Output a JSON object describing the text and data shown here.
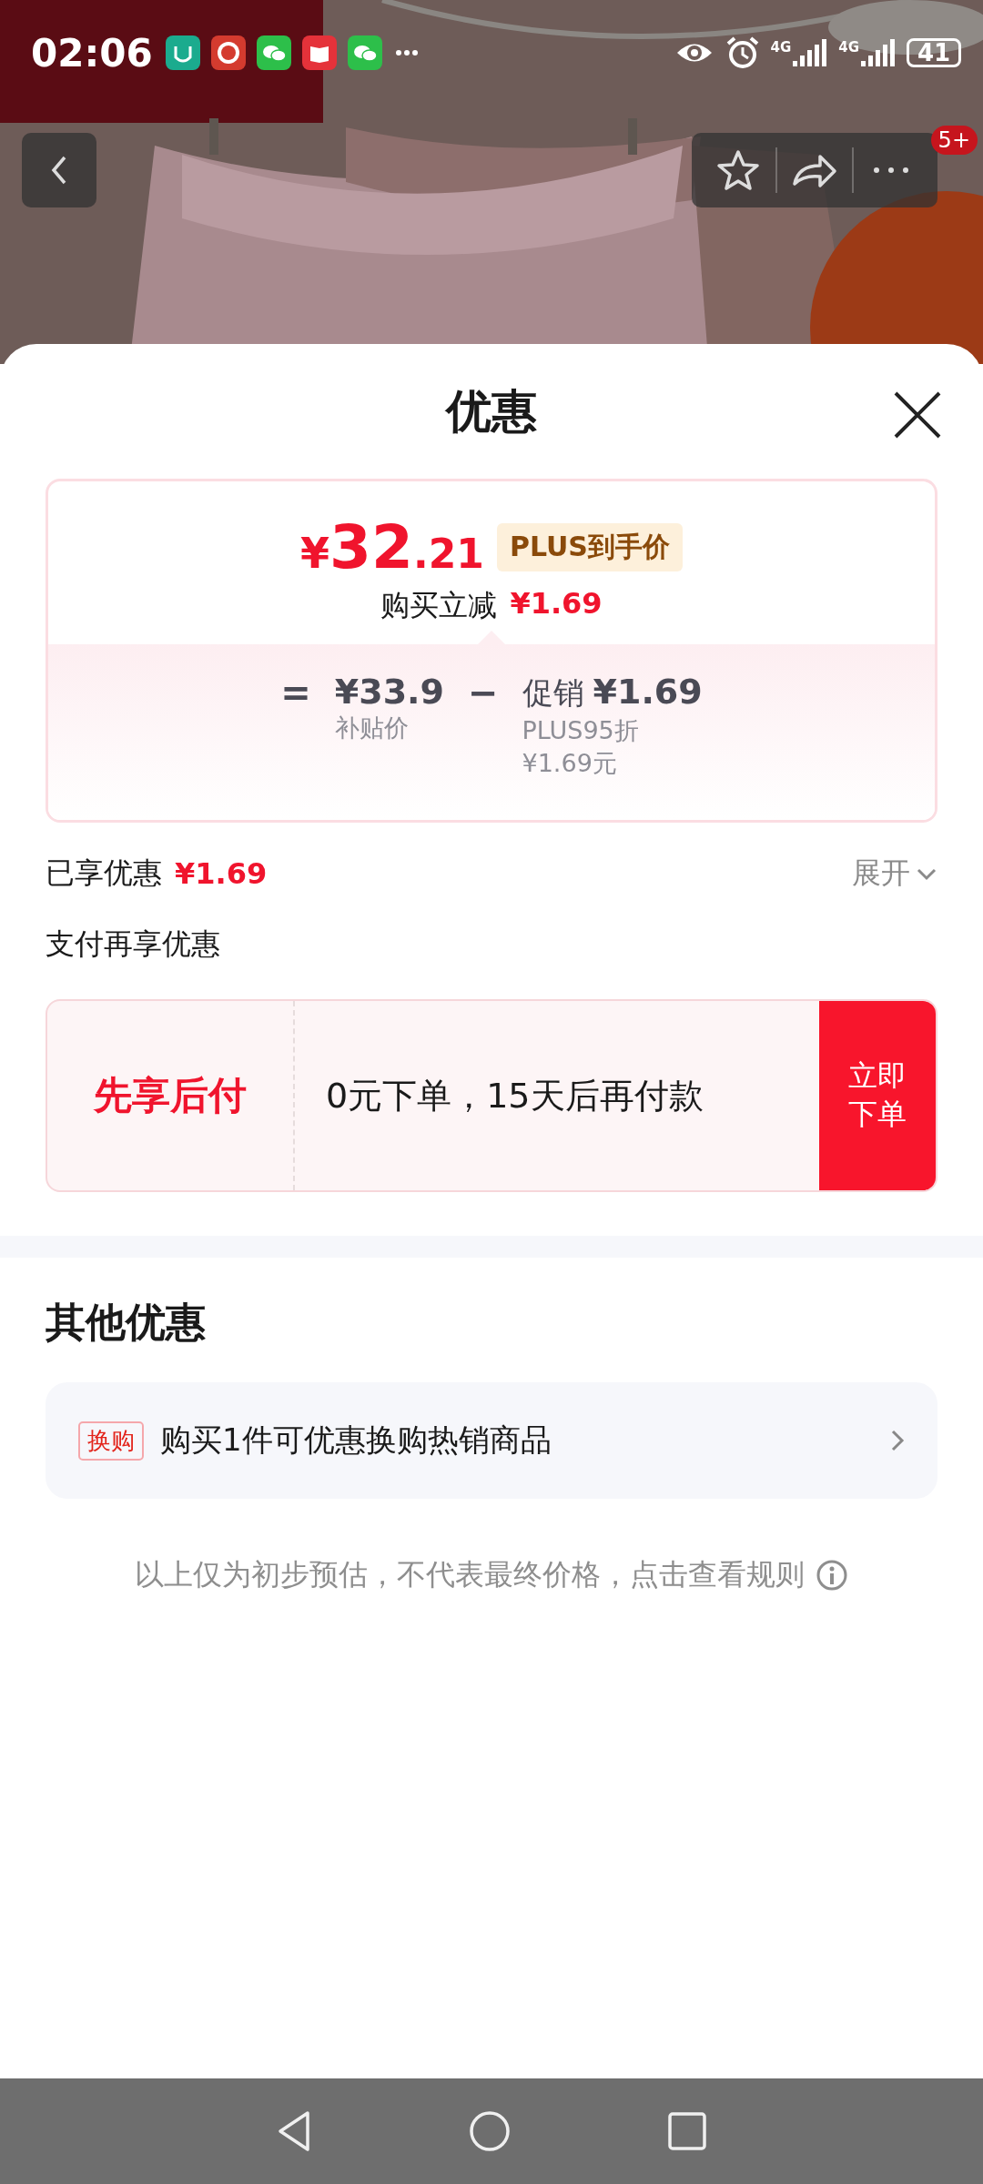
{
  "status_bar": {
    "time": "02:06",
    "network_labels": [
      "4G",
      "4G"
    ],
    "battery": "41"
  },
  "header": {
    "badge": "5+"
  },
  "sheet": {
    "title": "优惠",
    "price_card": {
      "currency": "¥",
      "price_main": "32",
      "price_decimal": ".21",
      "price_tag": "PLUS到手价",
      "instant_label": "购买立减",
      "instant_amount": "¥1.69",
      "equals": "=",
      "base_price": "¥33.9",
      "base_label": "补贴价",
      "minus": "−",
      "promo_label": "促销",
      "promo_amount": "¥1.69",
      "promo_detail_1": "PLUS95折",
      "promo_detail_2": "¥1.69元"
    },
    "enjoyed": {
      "label": "已享优惠",
      "amount": "¥1.69",
      "expand": "展开",
      "expanded": false
    },
    "pay_section_title": "支付再享优惠",
    "pay_later": {
      "title": "先享后付",
      "text": "0元下单，15天后再付款",
      "button": "立即下单"
    },
    "other_title": "其他优惠",
    "other_offers": [
      {
        "tag": "换购",
        "text": "购买1件可优惠换购热销商品"
      }
    ],
    "footnote": "以上仅为初步预估，不代表最终价格，点击查看规则"
  }
}
